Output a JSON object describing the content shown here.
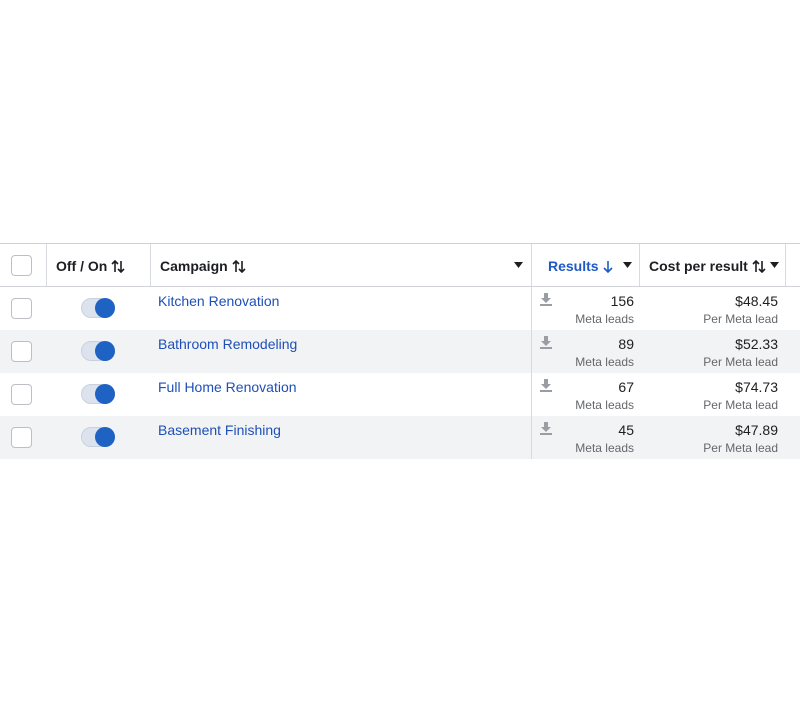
{
  "header": {
    "off_on": "Off / On",
    "campaign": "Campaign",
    "results": "Results",
    "cost_per_result": "Cost per result"
  },
  "colors": {
    "link": "#1e4fb8",
    "toggle_on": "#1e62c4",
    "row_alt": "#f2f3f5"
  },
  "rows": [
    {
      "campaign": "Kitchen Renovation",
      "results": "156",
      "results_unit": "Meta leads",
      "cost": "$48.45",
      "cost_unit": "Per Meta lead",
      "on": true
    },
    {
      "campaign": "Bathroom Remodeling",
      "results": "89",
      "results_unit": "Meta leads",
      "cost": "$52.33",
      "cost_unit": "Per Meta lead",
      "on": true
    },
    {
      "campaign": "Full Home Renovation",
      "results": "67",
      "results_unit": "Meta leads",
      "cost": "$74.73",
      "cost_unit": "Per Meta lead",
      "on": true
    },
    {
      "campaign": "Basement Finishing",
      "results": "45",
      "results_unit": "Meta leads",
      "cost": "$47.89",
      "cost_unit": "Per Meta lead",
      "on": true
    }
  ]
}
